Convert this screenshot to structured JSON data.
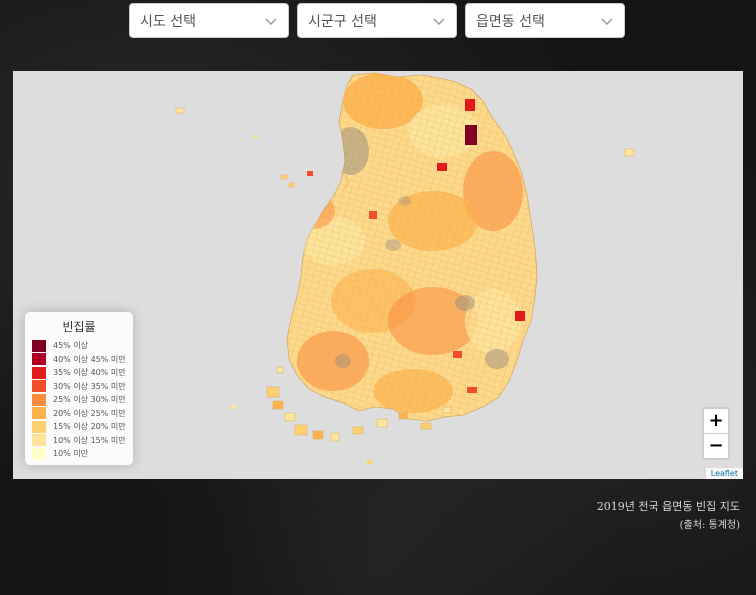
{
  "selects": {
    "sido": "시도 선택",
    "sigungu": "시군구 선택",
    "eupmyeondong": "읍면동 선택"
  },
  "legend": {
    "title": "빈집률",
    "items": [
      {
        "label": "45% 이상",
        "color": "#7f0023"
      },
      {
        "label": "40% 이상 45% 미만",
        "color": "#b10026"
      },
      {
        "label": "35% 이상 40% 미만",
        "color": "#e31a1c"
      },
      {
        "label": "30% 이상 35% 미만",
        "color": "#f04d2a"
      },
      {
        "label": "25% 이상 30% 미만",
        "color": "#fc8d3c"
      },
      {
        "label": "20% 이상 25% 미만",
        "color": "#feb24c"
      },
      {
        "label": "15% 이상 20% 미만",
        "color": "#fed06f"
      },
      {
        "label": "10% 이상 15% 미만",
        "color": "#fee49a"
      },
      {
        "label": "10% 미만",
        "color": "#ffffcc"
      }
    ]
  },
  "zoom": {
    "in": "+",
    "out": "−"
  },
  "attribution": "Leaflet",
  "caption": {
    "line1": "2019년 전국 읍면동 빈집 지도",
    "line2": "(출처: 통계청)"
  },
  "icons": {
    "select_arrow": "chevron-down-icon"
  }
}
